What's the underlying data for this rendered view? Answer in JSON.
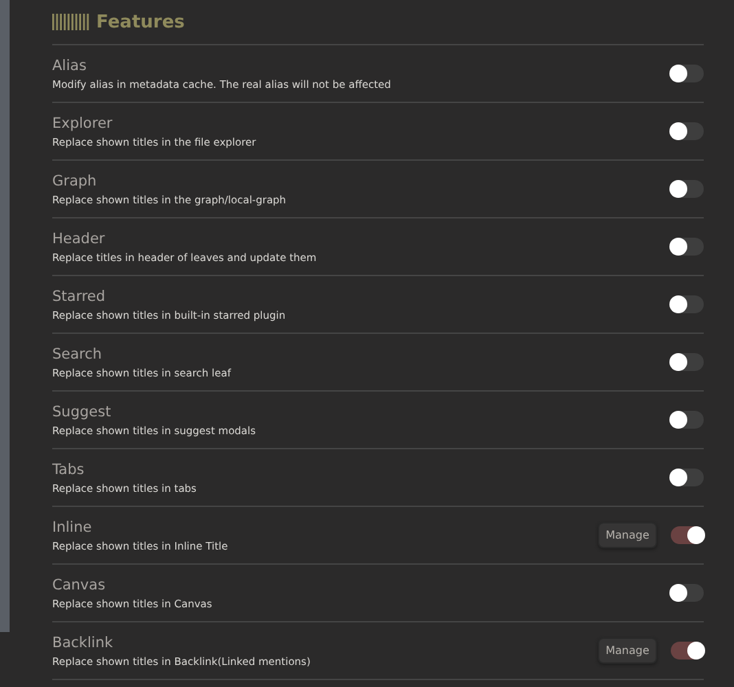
{
  "section": {
    "title": "Features"
  },
  "settings": [
    {
      "name": "Alias",
      "description": "Modify alias in metadata cache. The real alias will not be affected",
      "on": false
    },
    {
      "name": "Explorer",
      "description": "Replace shown titles in the file explorer",
      "on": false
    },
    {
      "name": "Graph",
      "description": "Replace shown titles in the graph/local-graph",
      "on": false
    },
    {
      "name": "Header",
      "description": "Replace titles in header of leaves and update them",
      "on": false
    },
    {
      "name": "Starred",
      "description": "Replace shown titles in built-in starred plugin",
      "on": false
    },
    {
      "name": "Search",
      "description": "Replace shown titles in search leaf",
      "on": false
    },
    {
      "name": "Suggest",
      "description": "Replace shown titles in suggest modals",
      "on": false
    },
    {
      "name": "Tabs",
      "description": "Replace shown titles in tabs",
      "on": false
    },
    {
      "name": "Inline",
      "description": "Replace shown titles in Inline Title",
      "on": true,
      "button": "Manage"
    },
    {
      "name": "Canvas",
      "description": "Replace shown titles in Canvas",
      "on": false
    },
    {
      "name": "Backlink",
      "description": "Replace shown titles in Backlink(Linked mentions)",
      "on": true,
      "button": "Manage"
    }
  ]
}
